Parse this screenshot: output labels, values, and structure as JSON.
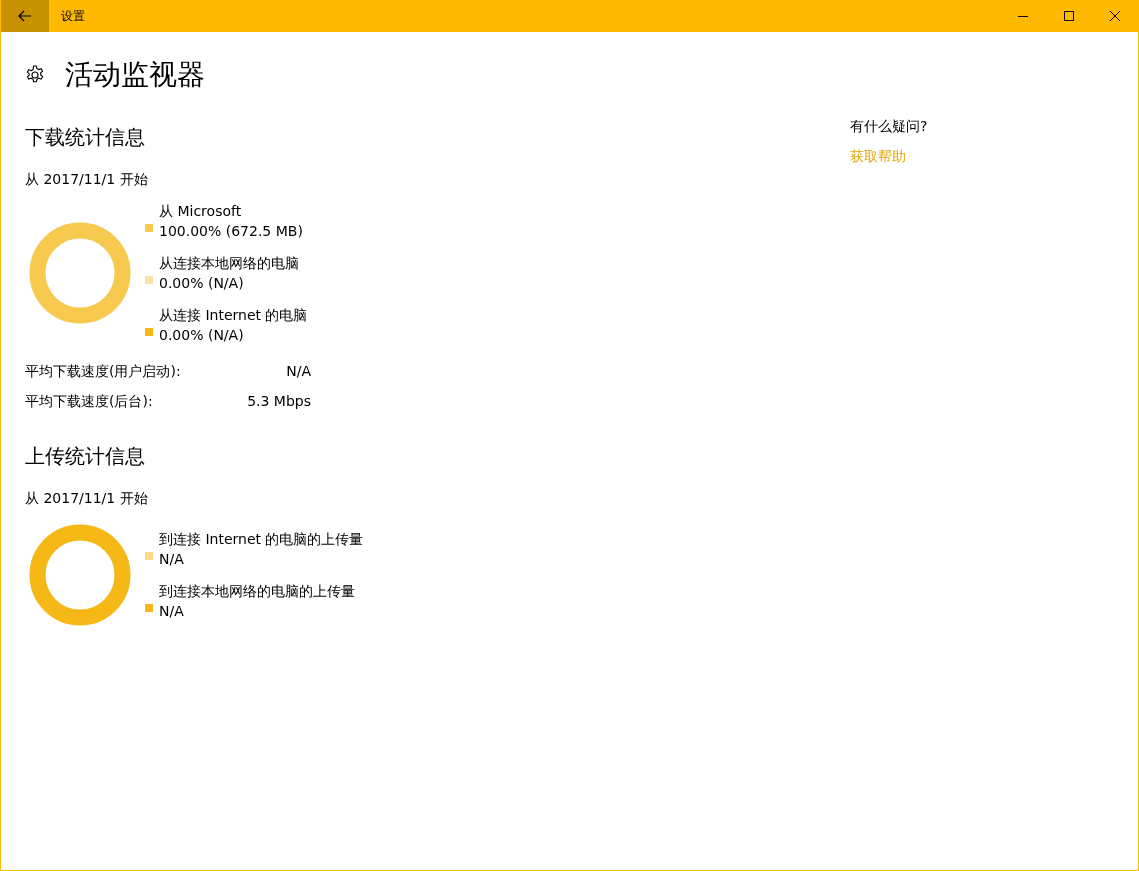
{
  "window": {
    "title": "设置"
  },
  "page": {
    "title": "活动监视器"
  },
  "download": {
    "heading": "下载统计信息",
    "since": "从 2017/11/1 开始",
    "legend": [
      {
        "label": "从 Microsoft",
        "value": "100.00%  (672.5 MB)",
        "color": "#f7c94f"
      },
      {
        "label": "从连接本地网络的电脑",
        "value": "0.00%  (N/A)",
        "color": "#fbe3a8"
      },
      {
        "label": "从连接 Internet 的电脑",
        "value": "0.00%  (N/A)",
        "color": "#f6b817"
      }
    ],
    "stats": [
      {
        "label": "平均下载速度(用户启动):",
        "value": "N/A"
      },
      {
        "label": "平均下载速度(后台):",
        "value": "5.3 Mbps"
      }
    ]
  },
  "upload": {
    "heading": "上传统计信息",
    "since": "从 2017/11/1 开始",
    "legend": [
      {
        "label": "到连接 Internet 的电脑的上传量",
        "value": "N/A",
        "color": "#fadb8a"
      },
      {
        "label": "到连接本地网络的电脑的上传量",
        "value": "N/A",
        "color": "#f6b817"
      }
    ]
  },
  "help": {
    "question": "有什么疑问?",
    "link": "获取帮助"
  }
}
